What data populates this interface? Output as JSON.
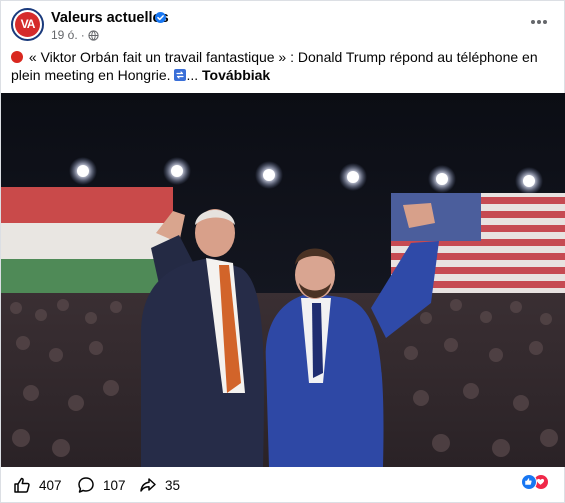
{
  "header": {
    "page_name": "Valeurs actuelles",
    "avatar_text": "VA",
    "timestamp": "19 ó.",
    "icons": [
      "verified-badge-icon",
      "globe-icon",
      "more-options-icon"
    ]
  },
  "caption": {
    "text": "« Viktor Orbán fait un travail fantastique » : Donald Trump répond au téléphone en plein meeting en Hongrie.",
    "ellipsis": "...",
    "see_more": "Továbbiak",
    "icons": [
      "red-circle-emoji",
      "arrows-emoji"
    ]
  },
  "photo": {
    "icon": "rally-photo"
  },
  "footer": {
    "likes": "407",
    "comments": "107",
    "shares": "35",
    "icons": [
      "like-icon",
      "comment-icon",
      "share-icon"
    ]
  },
  "reactions": {
    "icons": [
      "like-reaction-icon",
      "love-reaction-icon"
    ],
    "colors": {
      "like": "#1877f2",
      "love": "#f02849"
    }
  }
}
